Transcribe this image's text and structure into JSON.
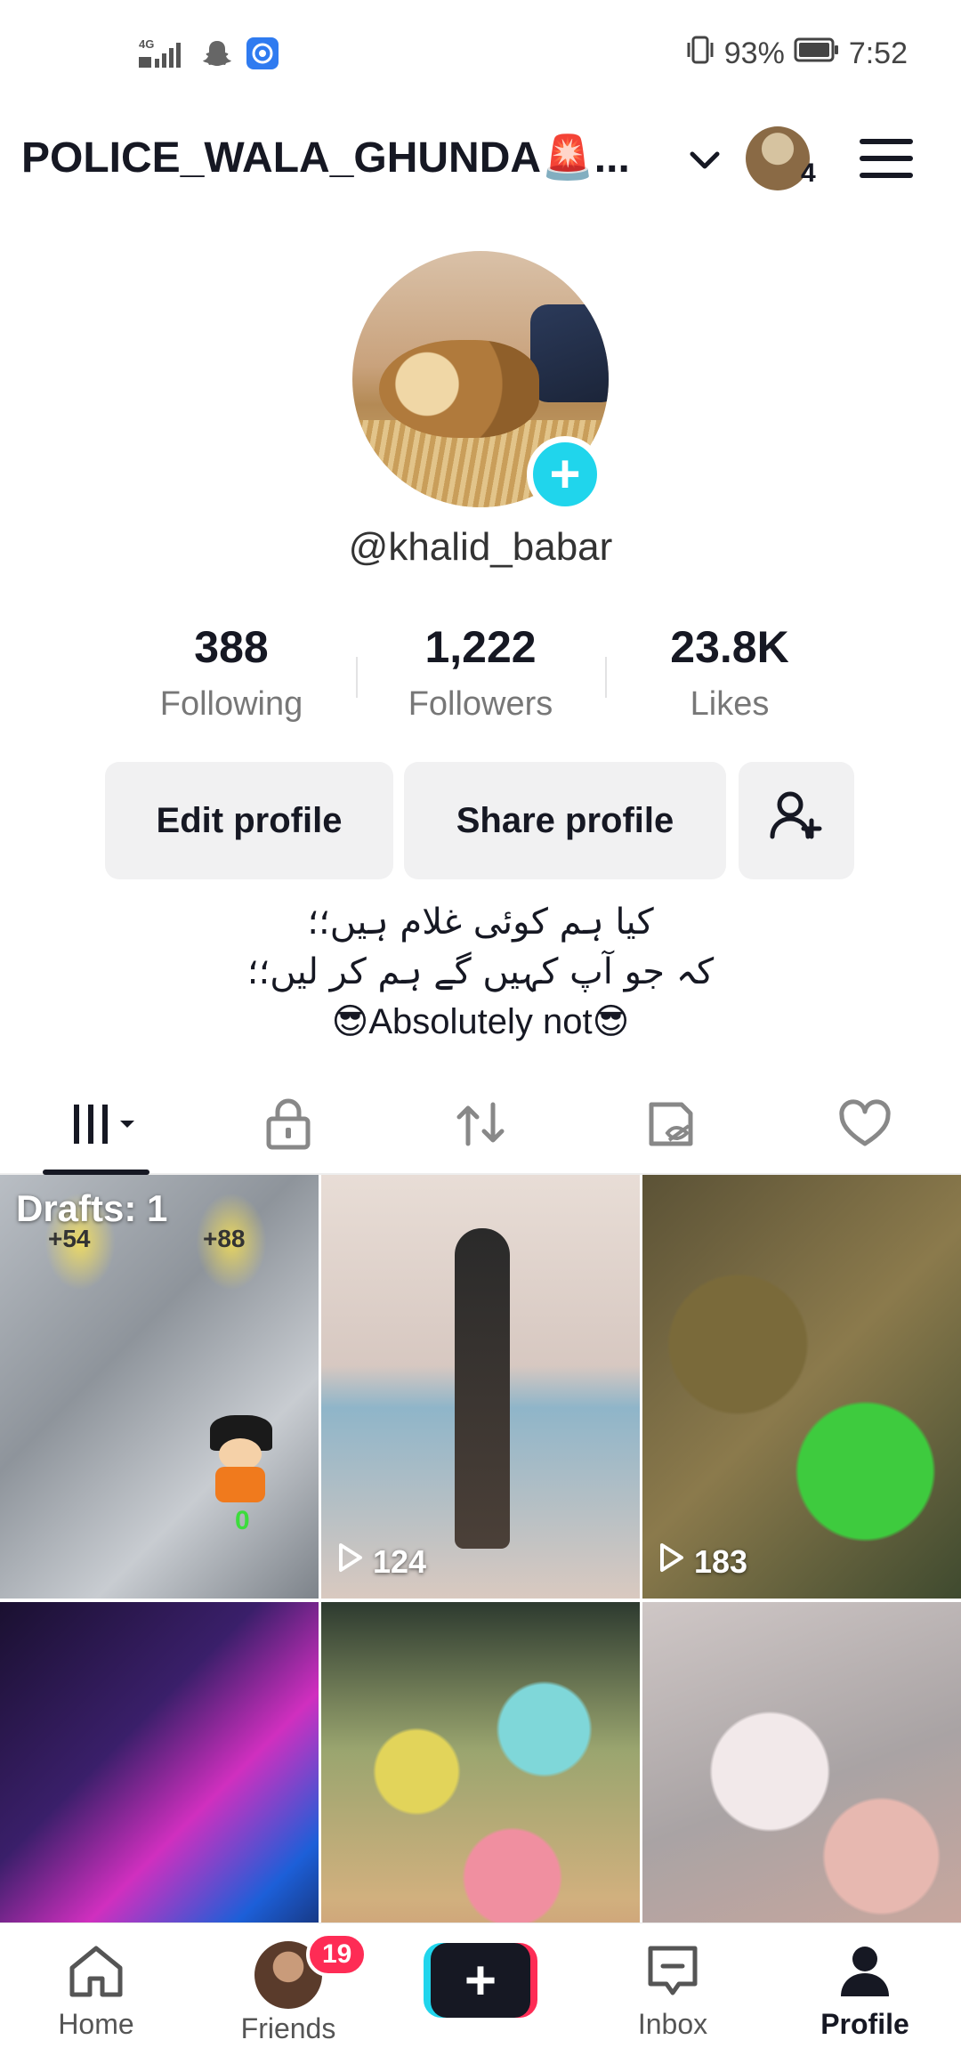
{
  "status_bar": {
    "network": "4G",
    "battery": "93%",
    "time": "7:52"
  },
  "header": {
    "username": "POLICE_WALA_GHUNDA🚨...",
    "account_count": "4"
  },
  "profile": {
    "handle": "@khalid_babar"
  },
  "stats": {
    "following": {
      "value": "388",
      "label": "Following"
    },
    "followers": {
      "value": "1,222",
      "label": "Followers"
    },
    "likes": {
      "value": "23.8K",
      "label": "Likes"
    }
  },
  "buttons": {
    "edit": "Edit profile",
    "share": "Share profile"
  },
  "bio": {
    "line1": "کیا ہم کوئی غلام ہیں؛؛",
    "line2": "کہ جو آپ کہیں گے ہم کر لیں؛؛",
    "line3": "😎Absolutely not😎"
  },
  "tabs": [
    "videos",
    "private",
    "reposts",
    "hidden",
    "liked"
  ],
  "videos": [
    {
      "drafts": "Drafts: 1",
      "overlay1": "+54",
      "overlay2": "+88",
      "overlay3": "0"
    },
    {
      "views": "124"
    },
    {
      "views": "183"
    },
    {},
    {},
    {}
  ],
  "bottom_nav": {
    "home": "Home",
    "friends": "Friends",
    "friends_badge": "19",
    "inbox": "Inbox",
    "profile": "Profile"
  },
  "colors": {
    "accent_cyan": "#20d5ec",
    "accent_red": "#fe2c55",
    "text_primary": "#161823"
  }
}
